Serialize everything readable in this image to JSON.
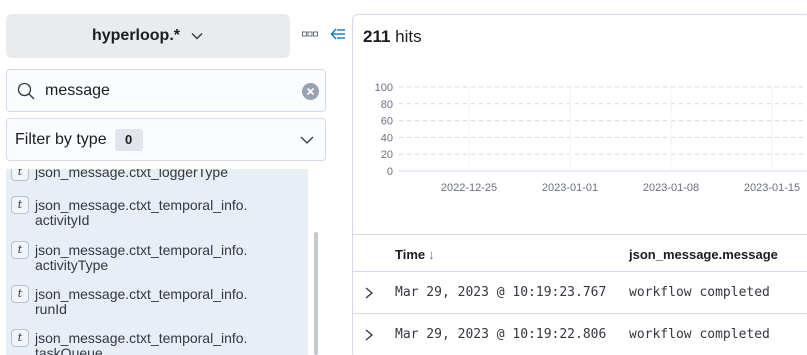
{
  "sidebar": {
    "index_pattern": "hyperloop.*",
    "search": {
      "value": "message"
    },
    "filter": {
      "label": "Filter by type",
      "count": "0"
    },
    "fields": [
      {
        "type": "t",
        "name": "json_message.ctxt_loggerType"
      },
      {
        "type": "t",
        "name": "json_message.ctxt_temporal_info.\nactivityId"
      },
      {
        "type": "t",
        "name": "json_message.ctxt_temporal_info.\nactivityType"
      },
      {
        "type": "t",
        "name": "json_message.ctxt_temporal_info.\nrunId"
      },
      {
        "type": "t",
        "name": "json_message.ctxt_temporal_info.\ntaskQueue"
      }
    ]
  },
  "main": {
    "hits_count": "211",
    "hits_label": "hits",
    "table": {
      "columns": [
        "Time",
        "json_message.message"
      ],
      "rows": [
        {
          "time": "Mar 29, 2023 @ 10:19:23.767",
          "message": "workflow completed"
        },
        {
          "time": "Mar 29, 2023 @ 10:19:22.806",
          "message": "workflow completed"
        }
      ]
    }
  },
  "chart_data": {
    "type": "bar",
    "y_ticks": [
      "100",
      "80",
      "60",
      "40",
      "20",
      "0"
    ],
    "x_ticks": [
      "2022-12-25",
      "2023-01-01",
      "2023-01-08",
      "2023-01-15"
    ],
    "ylim": [
      0,
      100
    ],
    "grid": true,
    "values": []
  },
  "colors": {
    "selected_field_bg": "#e8eef6",
    "accent": "#006bb8",
    "index_picker_bg": "#e9ebee"
  }
}
